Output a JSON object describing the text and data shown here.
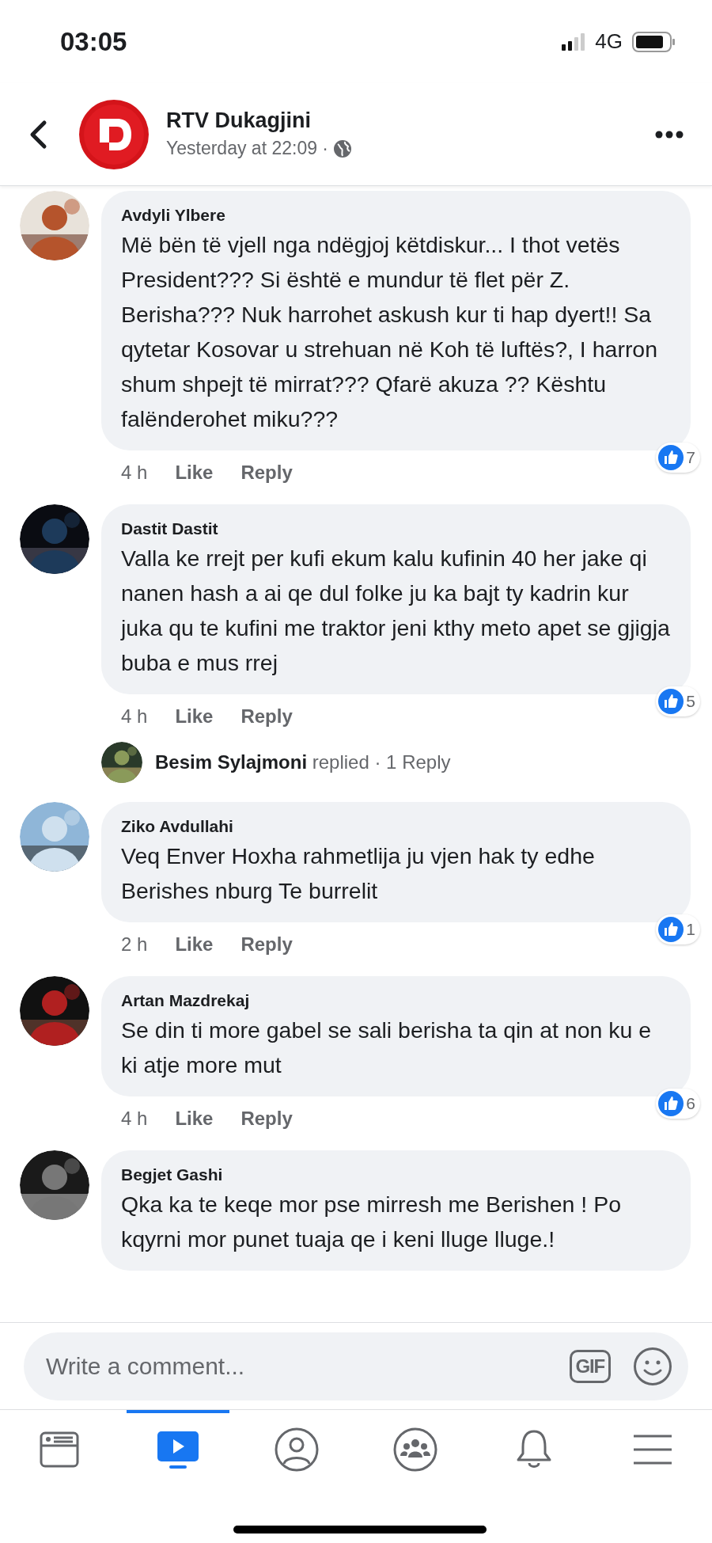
{
  "status_bar": {
    "time": "03:05",
    "network": "4G"
  },
  "header": {
    "title": "RTV Dukagjini",
    "subtitle": "Yesterday at 22:09 ·"
  },
  "comments": [
    {
      "name": "Avdyli Ylbere",
      "text": "Më bën të vjell nga ndëgjoj këtdiskur... I thot vetës President???  Si është e mundur të flet për Z. Berisha??? Nuk harrohet askush kur ti hap dyert!! Sa qytetar Kosovar u strehuan në Koh të luftës?, I harron shum shpejt të mirrat??? Qfarë akuza ?? Kështu falënderohet miku???",
      "time": "4 h",
      "like": "Like",
      "reply": "Reply",
      "reactions": "7"
    },
    {
      "name": "Dastit Dastit",
      "text": "Valla ke rrejt per kufi ekum kalu kufinin 40 her jake qi nanen hash a ai qe dul folke ju ka bajt ty kadrin kur juka qu te kufini me traktor jeni kthy meto apet se gjigja buba e mus rrej",
      "time": "4 h",
      "like": "Like",
      "reply": "Reply",
      "reactions": "5",
      "replies": "**Besim Sylajmoni** replied · 1 Reply"
    },
    {
      "name": "Ziko Avdullahi",
      "text": "Veq Enver Hoxha rahmetlija ju vjen hak ty edhe Berishes nburg Te burrelit",
      "time": "2 h",
      "like": "Like",
      "reply": "Reply",
      "reactions": "1"
    },
    {
      "name": "Artan Mazdrekaj",
      "text": "Se din ti more gabel se sali berisha ta qin at non ku e ki atje more mut",
      "time": "4 h",
      "like": "Like",
      "reply": "Reply",
      "reactions": "6"
    },
    {
      "name": "Begjet Gashi",
      "text": "Qka ka te keqe mor pse mirresh me Berishen ! Po kqyrni mor punet tuaja qe i keni  lluge lluge.!"
    }
  ],
  "composer": {
    "placeholder": "Write a comment...",
    "gif": "GIF"
  },
  "nav": [
    {
      "kind": "feed",
      "selected": false
    },
    {
      "kind": "watch",
      "selected": true
    },
    {
      "kind": "profile",
      "selected": false
    },
    {
      "kind": "groups",
      "selected": false
    },
    {
      "kind": "notifications",
      "selected": false
    },
    {
      "kind": "menu",
      "selected": false
    }
  ]
}
